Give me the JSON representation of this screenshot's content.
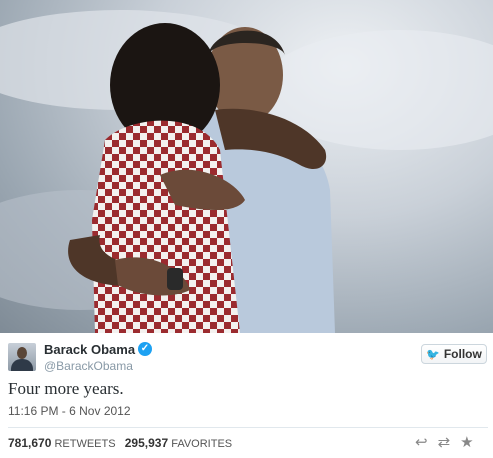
{
  "tweet": {
    "photo_alt": "photo",
    "author_name": "Barack Obama",
    "author_handle": "@BarackObama",
    "follow_label": "Follow",
    "text": "Four more years.",
    "timestamp": "11:16 PM - 6 Nov 2012",
    "retweets_count": "781,670",
    "retweets_label": "RETWEETS",
    "favorites_count": "295,937",
    "favorites_label": "FAVORITES",
    "verified_icon": "verified-icon",
    "actions": [
      "reply-icon",
      "retweet-icon",
      "favorite-icon"
    ]
  },
  "colors": {
    "verified": "#1da1f2",
    "text": "#292f33",
    "muted": "#8899a6",
    "divider": "#e1e8ed"
  }
}
